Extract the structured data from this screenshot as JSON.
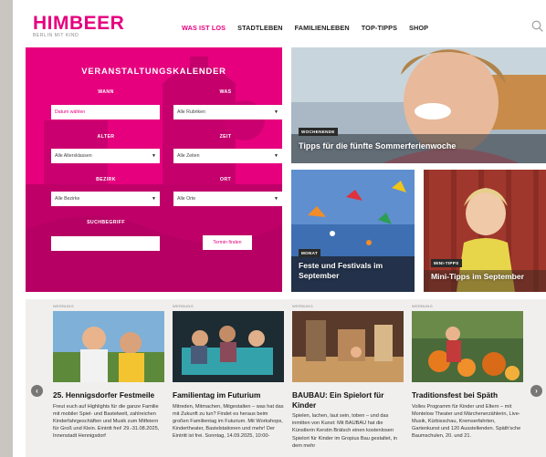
{
  "logo": {
    "name": "HIMBEER",
    "tagline": "BERLIN MIT KIND"
  },
  "nav": [
    {
      "label": "WAS IST LOS",
      "active": true
    },
    {
      "label": "STADTLEBEN",
      "active": false
    },
    {
      "label": "FAMILIENLEBEN",
      "active": false
    },
    {
      "label": "TOP-TIPPS",
      "active": false
    },
    {
      "label": "SHOP",
      "active": false
    }
  ],
  "calendar": {
    "title": "VERANSTALTUNGSKALENDER",
    "labels": {
      "wann": "WANN",
      "was": "WAS",
      "alter": "ALTER",
      "zeit": "ZEIT",
      "bezirk": "BEZIRK",
      "ort": "ORT",
      "suchbegriff": "SUCHBEGRIFF"
    },
    "fields": {
      "datum": "Datum wählen",
      "rubrik": "Alle Rubriken",
      "alter": "Alle Altersklassen",
      "zeit": "Alle Zeiten",
      "bezirk": "Alle Bezirke",
      "ort": "Alle Orte",
      "suchbegriff": ""
    },
    "button": "Termin finden"
  },
  "teasers": {
    "main": {
      "badge": "WOCHENENDE",
      "title": "Tipps für die fünfte Sommerferienwoche"
    },
    "left": {
      "badge": "MONAT",
      "title": "Feste und Festivals im September"
    },
    "right": {
      "badge": "MINI-TIPPS",
      "title": "Mini-Tipps im September"
    }
  },
  "cards": [
    {
      "werbung": "WERBUNG",
      "title": "25. Hennigsdorfer Festmeile",
      "text": "Freut euch auf Highlights für die ganze Familie mit mobiler Spiel- und Bastelwelt, zahlreichen Kinderfahrgeschäften und Musik zum Mitfeiern für Groß und Klein. Eintritt frei! 29.-31.08.2025, Innenstadt Hennigsdorf"
    },
    {
      "werbung": "WERBUNG",
      "title": "Familientag im Futurium",
      "text": "Mitreden, Mitmachen, Mitgestalten – was hat das mit Zukunft zu tun? Findet es heraus beim großen Familientag im Futurium. Mit Workshops, Kindertheater, Bastelstationen und mehr! Der Eintritt ist frei. Sonntag, 14.09.2025, 10:00-"
    },
    {
      "werbung": "WERBUNG",
      "title": "BAUBAU: Ein Spielort für Kinder",
      "text": "Spielen, lachen, laut sein, toben – und das inmitten von Kunst: Mit BAUBAU hat die Künstlerin Kerstin Brätsch einen kostenlosen Spielort für Kinder im Gropius Bau gestaltet, in dem mehr"
    },
    {
      "werbung": "WERBUNG",
      "title": "Traditionsfest bei Späth",
      "text": "Volles Programm für Kinder und Eltern – mit Montelow Theater und Märchenerzählerin, Live-Musik, Kürbisschau, Kremserfahrten, Gartenkunst und 120 Ausstellenden. Späth'sche Baumschulen, 20. und 21."
    }
  ],
  "colors": {
    "brand": "#e6007e",
    "badge": "#2a2a2a"
  }
}
